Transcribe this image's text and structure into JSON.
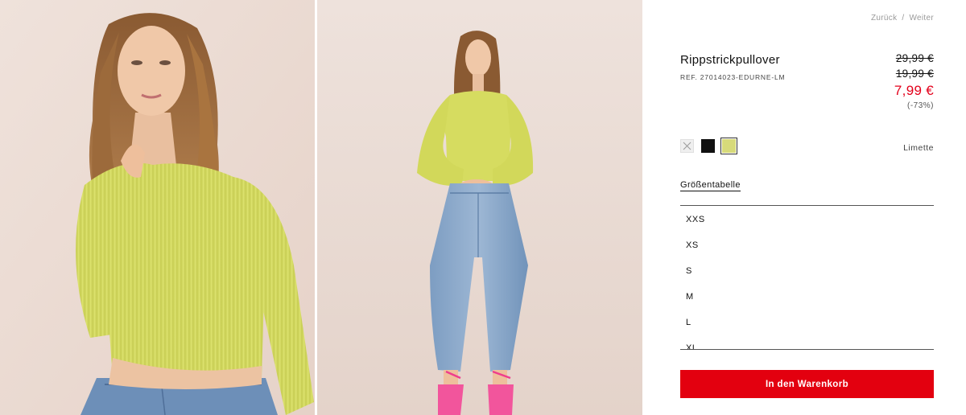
{
  "nav": {
    "back_label": "Zurück",
    "separator": "/",
    "next_label": "Weiter"
  },
  "gallery": {
    "images": [
      {
        "name": "model-closeup-photo"
      },
      {
        "name": "model-fullbody-photo"
      }
    ]
  },
  "product": {
    "title": "Rippstrickpullover",
    "reference": "REF. 27014023-EDURNE-LM",
    "prices": {
      "original": "29,99 €",
      "previous": "19,99 €",
      "current": "7,99 €",
      "discount": "(-73%)"
    },
    "colors": {
      "options": [
        {
          "name": "white-swatch",
          "hex": "#efefef",
          "available": false
        },
        {
          "name": "black-swatch",
          "hex": "#111111",
          "available": true
        },
        {
          "name": "lime-swatch",
          "hex": "#d7da7a",
          "available": true,
          "selected": true
        }
      ],
      "selected_label": "Limette"
    },
    "size_chart_label": "Größentabelle",
    "sizes": [
      "XXS",
      "XS",
      "S",
      "M",
      "L",
      "XL"
    ],
    "add_to_cart_label": "In den Warenkorb"
  },
  "colors": {
    "accent_red": "#e3000f",
    "price_red": "#e3001b",
    "background": "#ffffff"
  }
}
